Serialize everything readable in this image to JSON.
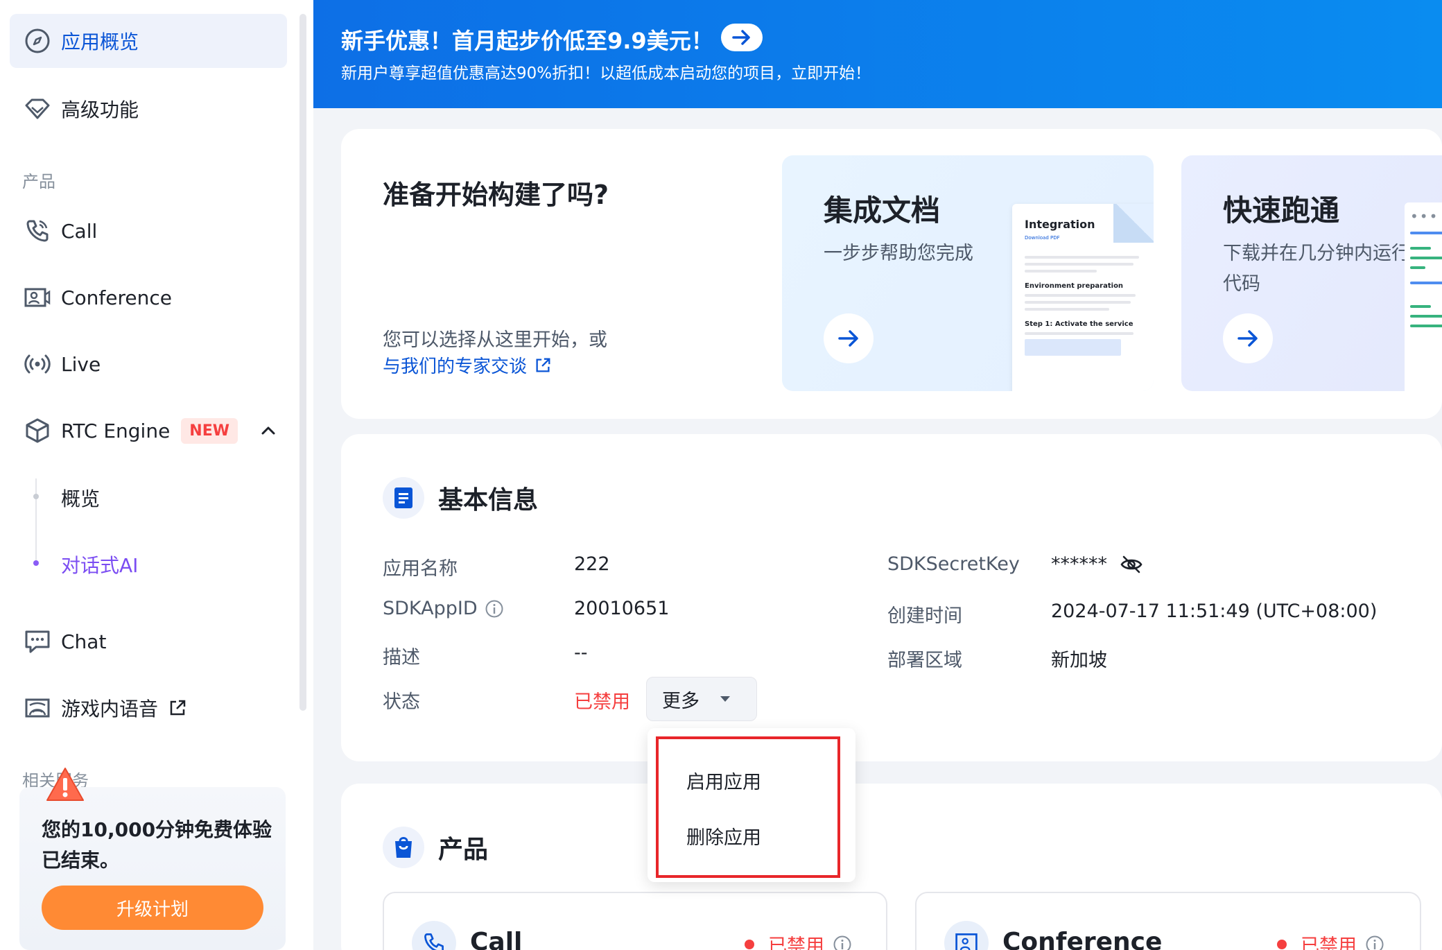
{
  "sidebar": {
    "items": [
      {
        "label": "应用概览",
        "icon": "compass-icon",
        "active": true
      },
      {
        "label": "高级功能",
        "icon": "diamond-icon"
      },
      {
        "label": "Call",
        "icon": "phone-icon"
      },
      {
        "label": "Conference",
        "icon": "conference-icon"
      },
      {
        "label": "Live",
        "icon": "broadcast-icon"
      },
      {
        "label": "RTC Engine",
        "icon": "cube-icon",
        "badge": "NEW"
      },
      {
        "label": "Chat",
        "icon": "chat-icon"
      },
      {
        "label": "游戏内语音",
        "icon": "gamepad-icon"
      }
    ],
    "section_products": "产品",
    "section_related": "相关服务",
    "sub_items": [
      {
        "label": "概览"
      },
      {
        "label": "对话式AI",
        "active": true
      }
    ],
    "trial": {
      "message": "您的10,000分钟免费体验已结束。",
      "upgrade_label": "升级计划"
    }
  },
  "banner": {
    "title": "新手优惠！首月起步价低至9.9美元！",
    "subtitle": "新用户尊享超值优惠高达90%折扣！以超低成本启动您的项目，立即开始！"
  },
  "getting_started": {
    "title": "准备开始构建了吗?",
    "desc": "您可以选择从这里开始，或",
    "link": "与我们的专家交谈",
    "docs_tile": {
      "title": "集成文档",
      "subtitle": "一步步帮助您完成",
      "preview": {
        "heading": "Integration",
        "link": "Download PDF",
        "section1": "Environment preparation",
        "section2": "Step 1: Activate the service"
      }
    },
    "quick_tile": {
      "title": "快速跑通",
      "subtitle": "下载并在几分钟内运行代码"
    }
  },
  "basic_info": {
    "title": "基本信息",
    "labels": {
      "app_name": "应用名称",
      "sdk_app_id": "SDKAppID",
      "description": "描述",
      "status": "状态",
      "secret_key": "SDKSecretKey",
      "created_at": "创建时间",
      "region": "部署区域"
    },
    "values": {
      "app_name": "222",
      "sdk_app_id": "20010651",
      "description": "--",
      "status": "已禁用",
      "secret_key": "******",
      "created_at": "2024-07-17 11:51:49 (UTC+08:00)",
      "region": "新加坡"
    },
    "more_label": "更多"
  },
  "dropdown": {
    "items": [
      "启用应用",
      "删除应用"
    ]
  },
  "products": {
    "title": "产品",
    "cards": [
      {
        "name": "Call",
        "status": "已禁用"
      },
      {
        "name": "Conference",
        "status": "已禁用"
      }
    ]
  },
  "colors": {
    "primary": "#0a55d6",
    "danger": "#f53f3f",
    "accent_purple": "#7b4df2",
    "upgrade": "#ff8a34",
    "highlight": "#e8262a"
  }
}
